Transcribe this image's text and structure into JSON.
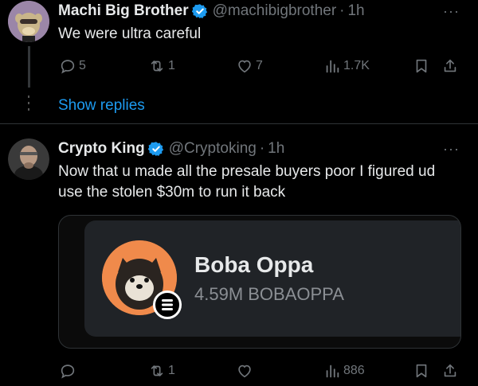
{
  "tweets": [
    {
      "author_name": "Machi Big Brother",
      "handle": "@machibigbrother",
      "separator": "·",
      "time": "1h",
      "text": "We were ultra careful",
      "replies": "5",
      "reposts": "1",
      "likes": "7",
      "views": "1.7K"
    },
    {
      "author_name": "Crypto King",
      "handle": "@Cryptoking",
      "separator": "·",
      "time": "1h",
      "text_line1": "Now that u made all the presale buyers poor I figured ud",
      "text_line2": "use the stolen $30m to run it back",
      "replies": "",
      "reposts": "1",
      "likes": "",
      "views": "886",
      "card": {
        "token_name": "Boba Oppa",
        "token_supply": "4.59M BOBAOPPA"
      }
    }
  ],
  "thread": {
    "show_replies": "Show replies"
  },
  "more_label": "···",
  "colors": {
    "background": "#000000",
    "text": "#e7e9ea",
    "muted": "#71767b",
    "link": "#1d9bf0",
    "verified": "#1d9bf0",
    "token_orange": "#f08a4b"
  }
}
